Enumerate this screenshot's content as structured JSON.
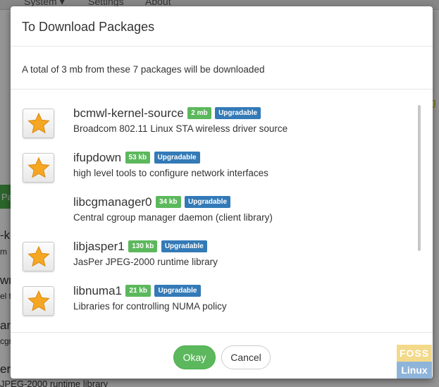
{
  "background": {
    "nav_items": [
      "System ▾",
      "Settings",
      "About"
    ],
    "tab_fragment": "Pa",
    "fragments": [
      "-ke",
      "m",
      "wn",
      "el t",
      "an",
      "cgr",
      "er",
      ""
    ],
    "bottom_line": "JPEG-2000 runtime library",
    "right_fragment": "J"
  },
  "dialog": {
    "title": "To Download Packages",
    "summary": "A total of 3 mb from these 7 packages will be downloaded",
    "packages": [
      {
        "name": "bcmwl-kernel-source",
        "size": "2 mb",
        "status": "Upgradable",
        "description": "Broadcom 802.11 Linux STA wireless driver source",
        "icon": "star-icon"
      },
      {
        "name": "ifupdown",
        "size": "53 kb",
        "status": "Upgradable",
        "description": "high level tools to configure network interfaces",
        "icon": "star-icon"
      },
      {
        "name": "libcgmanager0",
        "size": "34 kb",
        "status": "Upgradable",
        "description": "Central cgroup manager daemon (client library)",
        "icon": ""
      },
      {
        "name": "libjasper1",
        "size": "130 kb",
        "status": "Upgradable",
        "description": "JasPer JPEG-2000 runtime library",
        "icon": "star-icon"
      },
      {
        "name": "libnuma1",
        "size": "21 kb",
        "status": "Upgradable",
        "description": "Libraries for controlling NUMA policy",
        "icon": "star-icon"
      }
    ],
    "buttons": {
      "okay": "Okay",
      "cancel": "Cancel"
    }
  },
  "watermark": {
    "top": "FOSS",
    "bottom": "Linux"
  },
  "colors": {
    "size_badge": "#5cb85c",
    "status_badge": "#337ab7",
    "okay_button": "#5cb85c",
    "star_fill": "#f5a623"
  }
}
